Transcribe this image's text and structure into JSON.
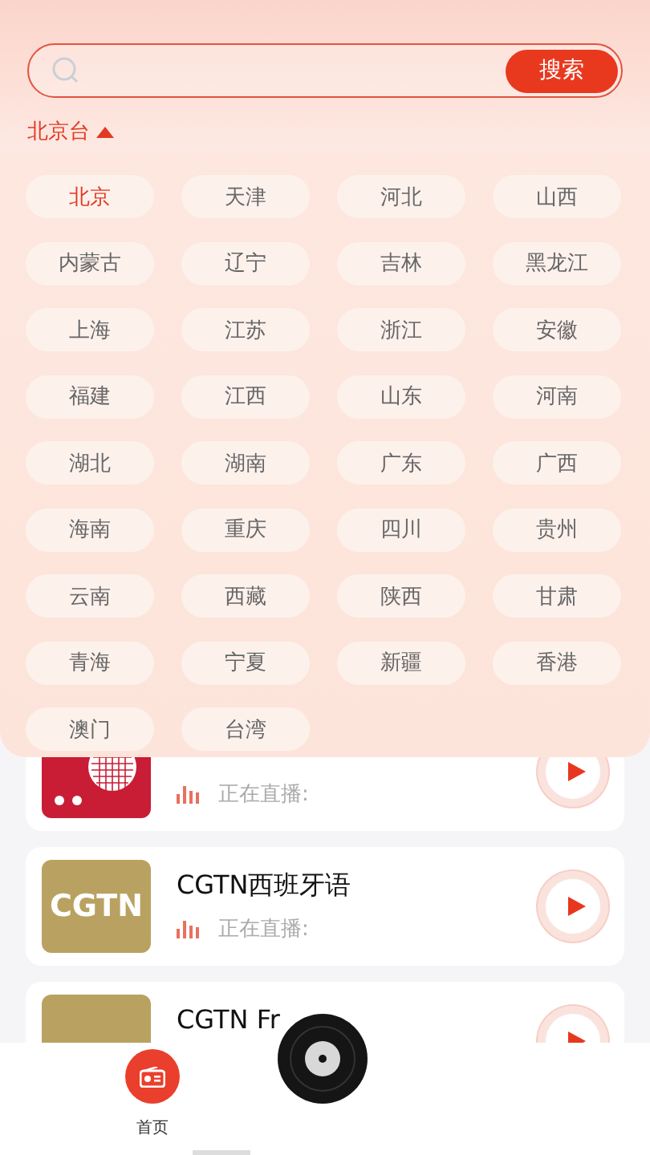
{
  "search": {
    "button": "搜索"
  },
  "region": {
    "label": "北京台",
    "expanded": true
  },
  "provinces": [
    {
      "label": "北京",
      "selected": true
    },
    {
      "label": "天津",
      "selected": false
    },
    {
      "label": "河北",
      "selected": false
    },
    {
      "label": "山西",
      "selected": false
    },
    {
      "label": "内蒙古",
      "selected": false
    },
    {
      "label": "辽宁",
      "selected": false
    },
    {
      "label": "吉林",
      "selected": false
    },
    {
      "label": "黑龙江",
      "selected": false
    },
    {
      "label": "上海",
      "selected": false
    },
    {
      "label": "江苏",
      "selected": false
    },
    {
      "label": "浙江",
      "selected": false
    },
    {
      "label": "安徽",
      "selected": false
    },
    {
      "label": "福建",
      "selected": false
    },
    {
      "label": "江西",
      "selected": false
    },
    {
      "label": "山东",
      "selected": false
    },
    {
      "label": "河南",
      "selected": false
    },
    {
      "label": "湖北",
      "selected": false
    },
    {
      "label": "湖南",
      "selected": false
    },
    {
      "label": "广东",
      "selected": false
    },
    {
      "label": "广西",
      "selected": false
    },
    {
      "label": "海南",
      "selected": false
    },
    {
      "label": "重庆",
      "selected": false
    },
    {
      "label": "四川",
      "selected": false
    },
    {
      "label": "贵州",
      "selected": false
    },
    {
      "label": "云南",
      "selected": false
    },
    {
      "label": "西藏",
      "selected": false
    },
    {
      "label": "陕西",
      "selected": false
    },
    {
      "label": "甘肃",
      "selected": false
    },
    {
      "label": "青海",
      "selected": false
    },
    {
      "label": "宁夏",
      "selected": false
    },
    {
      "label": "新疆",
      "selected": false
    },
    {
      "label": "香港",
      "selected": false
    },
    {
      "label": "澳门",
      "selected": false
    },
    {
      "label": "台湾",
      "selected": false
    }
  ],
  "stations": [
    {
      "logo": {
        "kind": "radio"
      },
      "status": "正在直播:"
    },
    {
      "logo": {
        "kind": "cgtn",
        "text": "CGTN"
      },
      "title": "CGTN西班牙语",
      "status": "正在直播:"
    },
    {
      "logo": {
        "kind": "cgtn"
      },
      "title": "CGTN Fr"
    }
  ],
  "nav": [
    {
      "label": "首页",
      "selected": true
    }
  ]
}
